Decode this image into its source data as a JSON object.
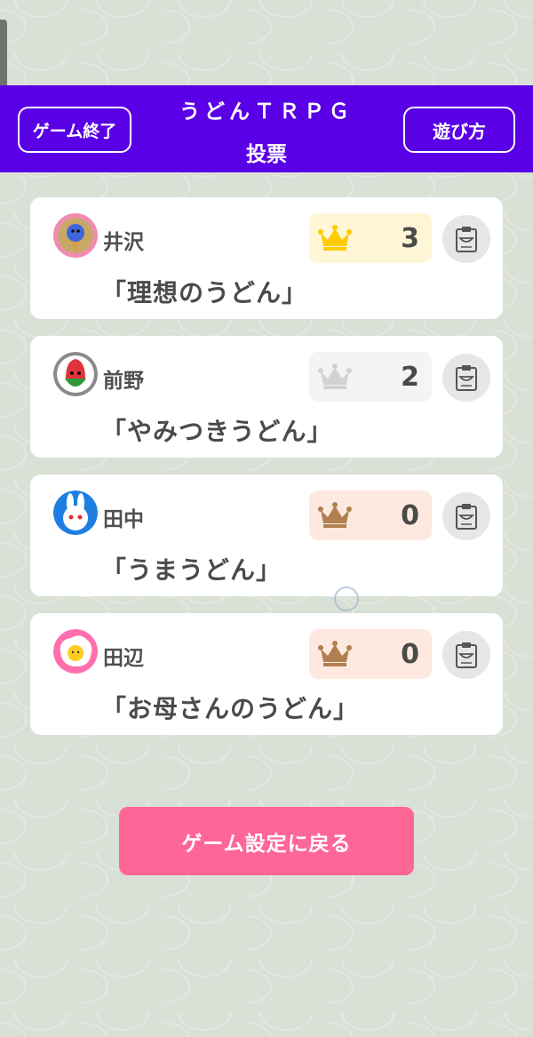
{
  "header": {
    "title": "うどんＴＲＰＧ",
    "subtitle": "投票",
    "end_game_label": "ゲーム終了",
    "how_to_play_label": "遊び方",
    "background_color": "#5a00e6"
  },
  "entries": [
    {
      "player": "井沢",
      "dish": "「理想のうどん」",
      "votes": "3",
      "rank": "gold",
      "avatar_icon": "blue-ghost-icecream-icon"
    },
    {
      "player": "前野",
      "dish": "「やみつきうどん」",
      "votes": "2",
      "rank": "silver",
      "avatar_icon": "red-radish-icon"
    },
    {
      "player": "田中",
      "dish": "「うまうどん」",
      "votes": "0",
      "rank": "bronze",
      "avatar_icon": "white-rabbit-icon"
    },
    {
      "player": "田辺",
      "dish": "「お母さんのうどん」",
      "votes": "0",
      "rank": "bronze",
      "avatar_icon": "fried-egg-icon"
    }
  ],
  "rank_colors": {
    "gold": {
      "box": "#fff6d6",
      "crown": "#ffcc00"
    },
    "silver": {
      "box": "#f4f4f4",
      "crown": "#d2d2d2"
    },
    "bronze": {
      "box": "#fde9df",
      "crown": "#b08050"
    }
  },
  "back_button_label": "ゲーム設定に戻る",
  "back_button_color": "#ff6698"
}
